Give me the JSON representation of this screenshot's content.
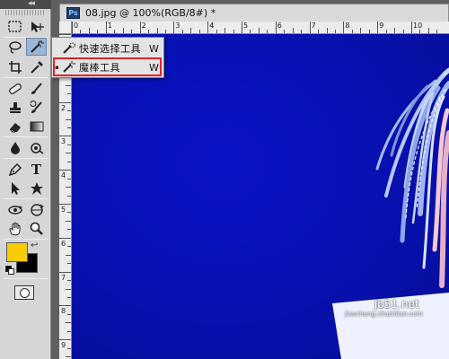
{
  "document": {
    "title": "08.jpg @ 100%(RGB/8#) *",
    "app_badge": "Ps"
  },
  "toolbox": {
    "chevrons": "◂◂",
    "foreground_color": "#f7cc00",
    "background_color": "#000000",
    "tools": [
      {
        "name": "rectangular-marquee-tool",
        "icon": "marquee-icon"
      },
      {
        "name": "move-tool",
        "icon": "move-icon"
      },
      {
        "name": "lasso-tool",
        "icon": "lasso-icon"
      },
      {
        "name": "magic-wand-tool",
        "icon": "magic-wand-icon"
      },
      {
        "name": "crop-tool",
        "icon": "crop-icon"
      },
      {
        "name": "eyedropper-tool",
        "icon": "eyedropper-icon"
      },
      {
        "name": "spot-healing-tool",
        "icon": "bandage-icon"
      },
      {
        "name": "brush-tool",
        "icon": "brush-icon"
      },
      {
        "name": "clone-stamp-tool",
        "icon": "stamp-icon"
      },
      {
        "name": "history-brush-tool",
        "icon": "history-brush-icon"
      },
      {
        "name": "eraser-tool",
        "icon": "eraser-icon"
      },
      {
        "name": "gradient-tool",
        "icon": "gradient-icon"
      },
      {
        "name": "blur-tool",
        "icon": "drop-icon"
      },
      {
        "name": "dodge-tool",
        "icon": "dodge-icon"
      },
      {
        "name": "pen-tool",
        "icon": "pen-icon"
      },
      {
        "name": "type-tool",
        "icon": "type-icon"
      },
      {
        "name": "path-selection-tool",
        "icon": "arrow-icon"
      },
      {
        "name": "custom-shape-tool",
        "icon": "shape-icon"
      },
      {
        "name": "3d-rotate-tool",
        "icon": "3d-rotate-icon"
      },
      {
        "name": "3d-orbit-tool",
        "icon": "3d-orbit-icon"
      },
      {
        "name": "hand-tool",
        "icon": "hand-icon"
      },
      {
        "name": "zoom-tool",
        "icon": "zoom-icon"
      }
    ],
    "type_tool_glyph": "T"
  },
  "flyout": {
    "items": [
      {
        "label": "快速选择工具",
        "shortcut": "W",
        "icon": "quick-selection-icon",
        "selected": false
      },
      {
        "label": "魔棒工具",
        "shortcut": "W",
        "icon": "magic-wand-icon",
        "selected": true
      }
    ],
    "bullet": "▪"
  },
  "ruler_top": {
    "labels": [
      "0",
      "1",
      "2",
      "3",
      "4",
      "5",
      "6",
      "7",
      "8",
      "9",
      "10"
    ]
  },
  "ruler_left": {
    "labels": [
      "1",
      "2",
      "3",
      "4",
      "5",
      "6",
      "7",
      "8",
      "9"
    ]
  },
  "watermark": {
    "text": "jb51.net",
    "sub": "jiaocheng.chazidian.com"
  }
}
